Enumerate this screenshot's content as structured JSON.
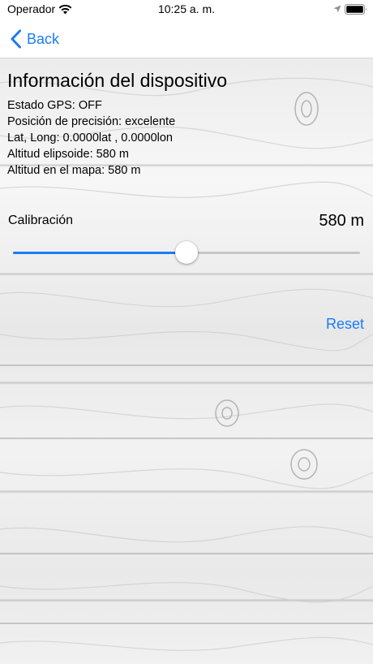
{
  "status_bar": {
    "carrier": "Operador",
    "time": "10:25 a. m."
  },
  "nav": {
    "back_label": "Back"
  },
  "info": {
    "title": "Información del dispositivo",
    "lines": [
      "Estado GPS:  OFF",
      "Posición de precisión: excelente",
      "Lat, Long: 0.0000lat , 0.0000lon",
      "Altitud elipsoide: 580 m",
      "Altitud en el mapa: 580 m"
    ]
  },
  "calibration": {
    "label": "Calibración",
    "value_text": "580 m",
    "slider_fraction": 0.5
  },
  "actions": {
    "reset_label": "Reset"
  },
  "colors": {
    "accent": "#1a7cf5"
  },
  "icons": {
    "wifi": "wifi-icon",
    "location": "location-arrow-icon",
    "battery": "battery-icon",
    "back": "chevron-left-icon"
  }
}
